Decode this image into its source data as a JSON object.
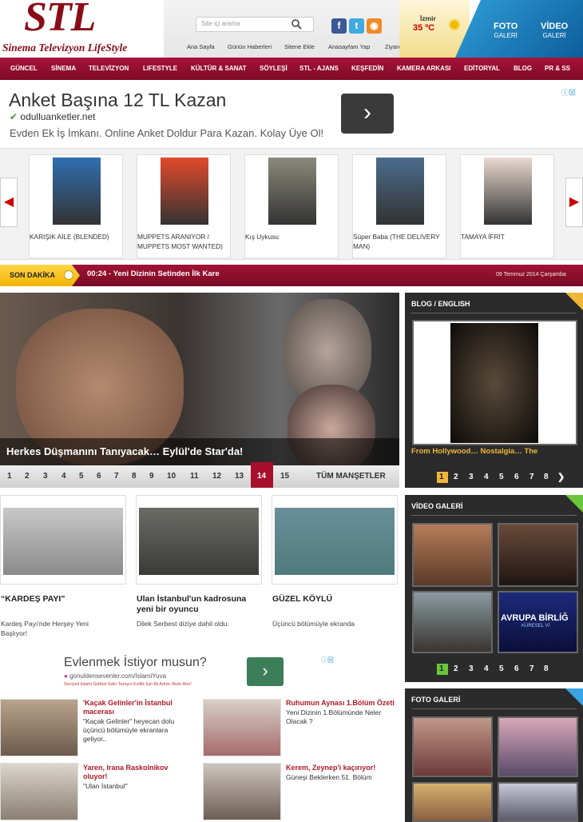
{
  "logo": {
    "main": "STL",
    "sub": "Sinema Televizyon LifeStyle"
  },
  "search": {
    "placeholder": "Site içi arama"
  },
  "toplinks": [
    "Ana Sayfa",
    "Günün Haberleri",
    "Sitene Ekle",
    "Anasayfam Yap",
    "Ziyaretçi Defteri"
  ],
  "weather": {
    "city": "İzmir",
    "temp": "35 ºC"
  },
  "gallery_buttons": [
    {
      "top": "FOTO",
      "bottom": "GALERİ"
    },
    {
      "top": "VİDEO",
      "bottom": "GALERİ"
    }
  ],
  "nav": [
    "GÜNCEL",
    "SİNEMA",
    "TELEVİZYON",
    "LIFESTYLE",
    "KÜLTÜR & SANAT",
    "SÖYLEŞİ",
    "STL - AJANS",
    "KEŞFEDİN",
    "KAMERA ARKASI",
    "EDİTORYAL",
    "BLOG",
    "PR & SS"
  ],
  "ad1": {
    "title": "Anket Başına 12 TL Kazan",
    "url": "odulluanketler.net",
    "desc": "Evden Ek İş İmkanı. Online Anket Doldur Para Kazan. Kolay Üye Ol!",
    "btn": "›"
  },
  "carousel": [
    {
      "label": "KARIŞIK AİLE (BLENDED)",
      "color": "#2f6fb0"
    },
    {
      "label": "MUPPETS ARANIYOR / MUPPETS MOST WANTED)",
      "color": "#e24a2b"
    },
    {
      "label": "Kış Uykusu",
      "color": "#8c8a7b"
    },
    {
      "label": "Süper Baba (THE DELIVERY MAN)",
      "color": "#4a6c8c"
    },
    {
      "label": "TAMAYA İFRİT",
      "color": "#e9d9d0"
    }
  ],
  "sondakika": {
    "label": "SON DAKİKA",
    "news": "00:24 - Yeni Dizinin Setinden İlk Kare",
    "date": "09 Temmuz 2014 Çarşamba"
  },
  "slider": {
    "caption": "Herkes Düşmanını Tanıyacak… Eylül'de Star'da!",
    "pages": [
      "1",
      "2",
      "3",
      "4",
      "5",
      "6",
      "7",
      "8",
      "9",
      "10",
      "11",
      "12",
      "13",
      "14",
      "15"
    ],
    "active": "14",
    "all": "TÜM MANŞETLER"
  },
  "cards": [
    {
      "title": "“KARDEŞ PAYI”",
      "desc": "Kardeş Payı'nde Herşey Yeni Başlıyor!"
    },
    {
      "title": "Ulan İstanbul'un kadrosuna yeni bir oyuncu",
      "desc": "Dilek Serbest diziye dahil oldu."
    },
    {
      "title": "GÜZEL KÖYLÜ",
      "desc": "Üçüncü bölümüyle ekranda"
    }
  ],
  "ad2": {
    "title": "Evlenmek İstiyor musun?",
    "url": "gonuldensevenler.com/IslamiYuva",
    "desc": "Seviyeli İslami Sohbet Edin Tanışın Evlilik İçin İlk Adımı Bizle Atın!",
    "btn": "›"
  },
  "bottom": [
    {
      "title": "'Kaçak Gelinler'in İstanbul macerası",
      "desc": "\"Kaçak Gelinler\" heyecan dolu üçüncü bölümüyle ekranlara geliyor.."
    },
    {
      "title": "Ruhumun Aynası 1.Bölüm Özeti",
      "desc": "Yeni Dizinin 1.Bölümünde Neler Olacak ?"
    },
    {
      "title": "Yaren, Irana Raskolnikov oluyor!",
      "desc": "\"Ulan İstanbul\""
    },
    {
      "title": "Kerem, Zeynep'i kaçırıyor!",
      "desc": "Güneşi Beklerken 51. Bölüm"
    }
  ],
  "blog": {
    "header": "BLOG / ENGLISH",
    "caption": "From Hollywood… Nostalgia… The",
    "pages": [
      "1",
      "2",
      "3",
      "4",
      "5",
      "6",
      "7",
      "8"
    ],
    "active": "1"
  },
  "video": {
    "header": "VİDEO GALERİ",
    "thumb_text": "AVRUPA BİRLİĞ",
    "thumb_sub": "KÜRESEL Vİ",
    "pages": [
      "1",
      "2",
      "3",
      "4",
      "5",
      "6",
      "7",
      "8"
    ],
    "active": "1"
  },
  "foto": {
    "header": "FOTO GALERİ"
  }
}
